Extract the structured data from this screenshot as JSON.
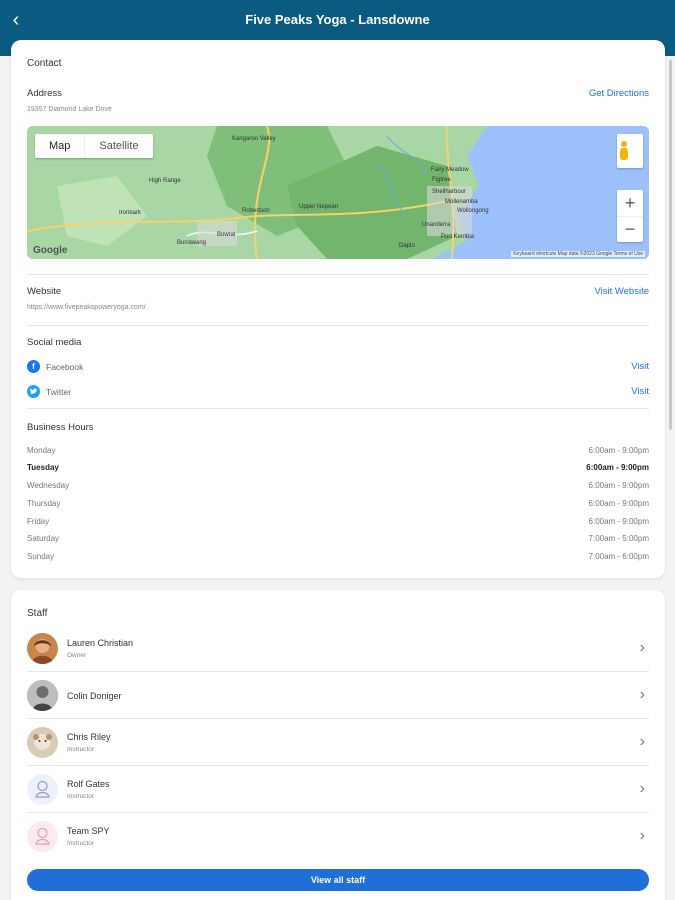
{
  "header": {
    "title": "Five Peaks Yoga - Lansdowne",
    "back_icon": "chevron-left-icon"
  },
  "contact": {
    "heading": "Contact",
    "address": {
      "label": "Address",
      "value": "19357 Diamond Lake Drive",
      "action": "Get Directions"
    },
    "map": {
      "tabs": [
        "Map",
        "Satellite"
      ],
      "zoom_in": "+",
      "zoom_out": "−",
      "logo": "Google",
      "attribution": "Keyboard shortcuts   Map data ©2023 Google   Terms of Use",
      "places": [
        "Kangaroo Valley",
        "High Range",
        "Ironbark",
        "Figtree",
        "Shellharbour",
        "Fairy Meadow",
        "Wollongong",
        "Mollenamba",
        "Unanderra",
        "Bowral",
        "Robertson",
        "Burrawang",
        "Dapto",
        "Port Kembla",
        "Upper Nepean"
      ],
      "colors": {
        "land": "#a9d6a5",
        "forest": "#7fbf7a",
        "water": "#9cc0f9",
        "road": "#f4d46a"
      }
    },
    "website": {
      "label": "Website",
      "value": "https://www.fivepeakspoweryoga.com/",
      "action": "Visit Website"
    },
    "social": {
      "heading": "Social media",
      "items": [
        {
          "name": "Facebook",
          "action": "Visit",
          "icon": "facebook-icon",
          "color": "#1877f2"
        },
        {
          "name": "Twitter",
          "action": "Visit",
          "icon": "twitter-icon",
          "color": "#1da1f2"
        }
      ]
    },
    "hours": {
      "heading": "Business Hours",
      "rows": [
        {
          "day": "Monday",
          "time": "6:00am - 9:00pm"
        },
        {
          "day": "Tuesday",
          "time": "6:00am - 9:00pm"
        },
        {
          "day": "Wednesday",
          "time": "6:00am - 9:00pm"
        },
        {
          "day": "Thursday",
          "time": "6:00am - 9:00pm"
        },
        {
          "day": "Friday",
          "time": "6:00am - 9:00pm"
        },
        {
          "day": "Saturday",
          "time": "7:00am - 5:00pm"
        },
        {
          "day": "Sunday",
          "time": "7:00am - 6:00pm"
        }
      ],
      "highlighted_day": "Tuesday"
    }
  },
  "staff": {
    "heading": "Staff",
    "members": [
      {
        "name": "Lauren Christian",
        "role": "Owner"
      },
      {
        "name": "Colin Doniger",
        "role": ""
      },
      {
        "name": "Chris Riley",
        "role": "Instructor"
      },
      {
        "name": "Rolf Gates",
        "role": "Instructor"
      },
      {
        "name": "Team SPY",
        "role": "Instructor"
      }
    ],
    "view_all": "View all staff"
  },
  "colors": {
    "header": "#0b5a82",
    "accent": "#1f6fd6"
  }
}
